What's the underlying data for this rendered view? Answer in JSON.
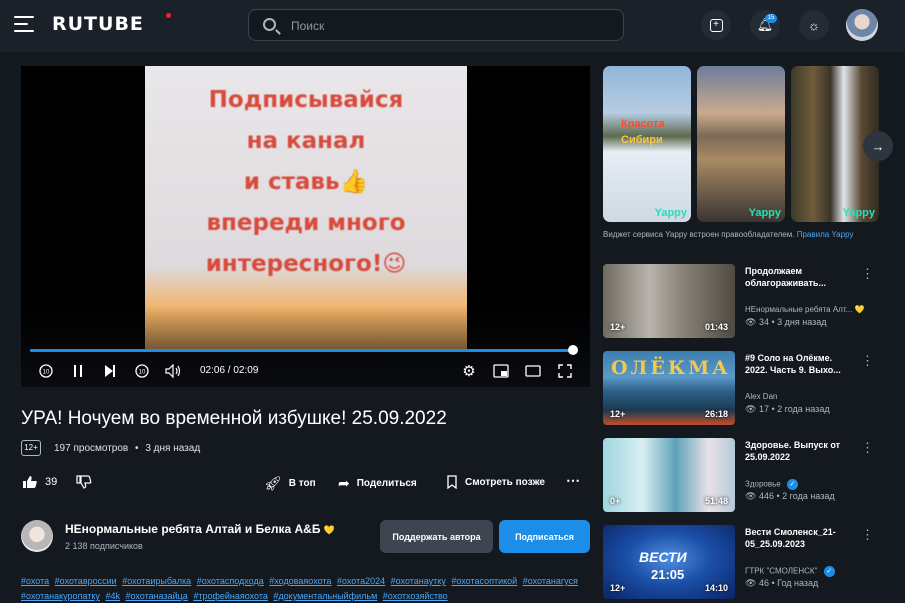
{
  "header": {
    "logo": "RUTUBE",
    "search_placeholder": "Поиск",
    "notification_count": "15"
  },
  "player": {
    "overlay_text": "Подписывайся\nна канал\nи ставь👍\nвпереди много\nинтересного!😉",
    "progress": 0.99,
    "time": "02:06 / 02:09"
  },
  "video": {
    "title": "УРА! Ночуем во временной избушке! 25.09.2022",
    "age": "12+",
    "views": "197 просмотров",
    "dot": "•",
    "date": "3 дня назад",
    "likes": "39"
  },
  "actions": {
    "top": "В топ",
    "share": "Поделиться",
    "watch_later": "Смотреть позже"
  },
  "channel": {
    "name": "НЕнормальные ребята\u0001 Алтай и Белка А&Б",
    "heart": "💛",
    "subscribers": "2 138 подписчиков",
    "support_label": "Поддержать автора",
    "subscribe_label": "Подписаться"
  },
  "tags": [
    "#охота",
    "#охотавроссии",
    "#охотаирыбалка",
    "#охотасподхода",
    "#ходоваяохота",
    "#охота2024",
    "#охотанаутку",
    "#охотасоптикой",
    "#охотанагуся",
    "#охотанакуропатку",
    "#4k",
    "#охотаназайца",
    "#трофейнаяохота",
    "#документальныйфильм",
    "#охотхозяйство"
  ],
  "yappy": {
    "clip1_caption_line1": "Красота",
    "clip1_caption_line2": "Сибири",
    "logo": "Yappy",
    "note": "Виджет сервиса Yappy встроен правообладателем.",
    "note_link": "Правила Yappy"
  },
  "recommendations": [
    {
      "title": "Продолжаем облагораживать...",
      "channel": "НЕнормальные ребята  Алт...",
      "heart": "💛",
      "verified": false,
      "views": "34",
      "date": "3 дня назад",
      "age": "12+",
      "duration": "01:43"
    },
    {
      "title": "#9 Соло на Олёкме. 2022. Часть 9. Выхо...",
      "channel": "Alex Dan",
      "heart": "",
      "verified": false,
      "views": "17",
      "date": "2 года назад",
      "age": "12+",
      "duration": "26:18",
      "thumb_text": "ОЛЁКМА"
    },
    {
      "title": "Здоровье. Выпуск от 25.09.2022",
      "channel": "Здоровье",
      "heart": "",
      "verified": true,
      "views": "446",
      "date": "2 года назад",
      "age": "0+",
      "duration": "51:48"
    },
    {
      "title": "Вести Смоленск_21-05_25.09.2023",
      "channel": "ГТРК \"СМОЛЕНСК\"",
      "heart": "",
      "verified": true,
      "views": "46",
      "date": "Год назад",
      "age": "12+",
      "duration": "14:10",
      "thumb_text": "ВЕСТИ",
      "thumb_time": "21:05"
    }
  ],
  "colors": {
    "background": "#14191f",
    "header": "#1b2129",
    "accent": "#1c8ee8",
    "logo_dot": "#ff1a3c",
    "link": "#4aa6f4",
    "yappy": "#25e0b6"
  }
}
